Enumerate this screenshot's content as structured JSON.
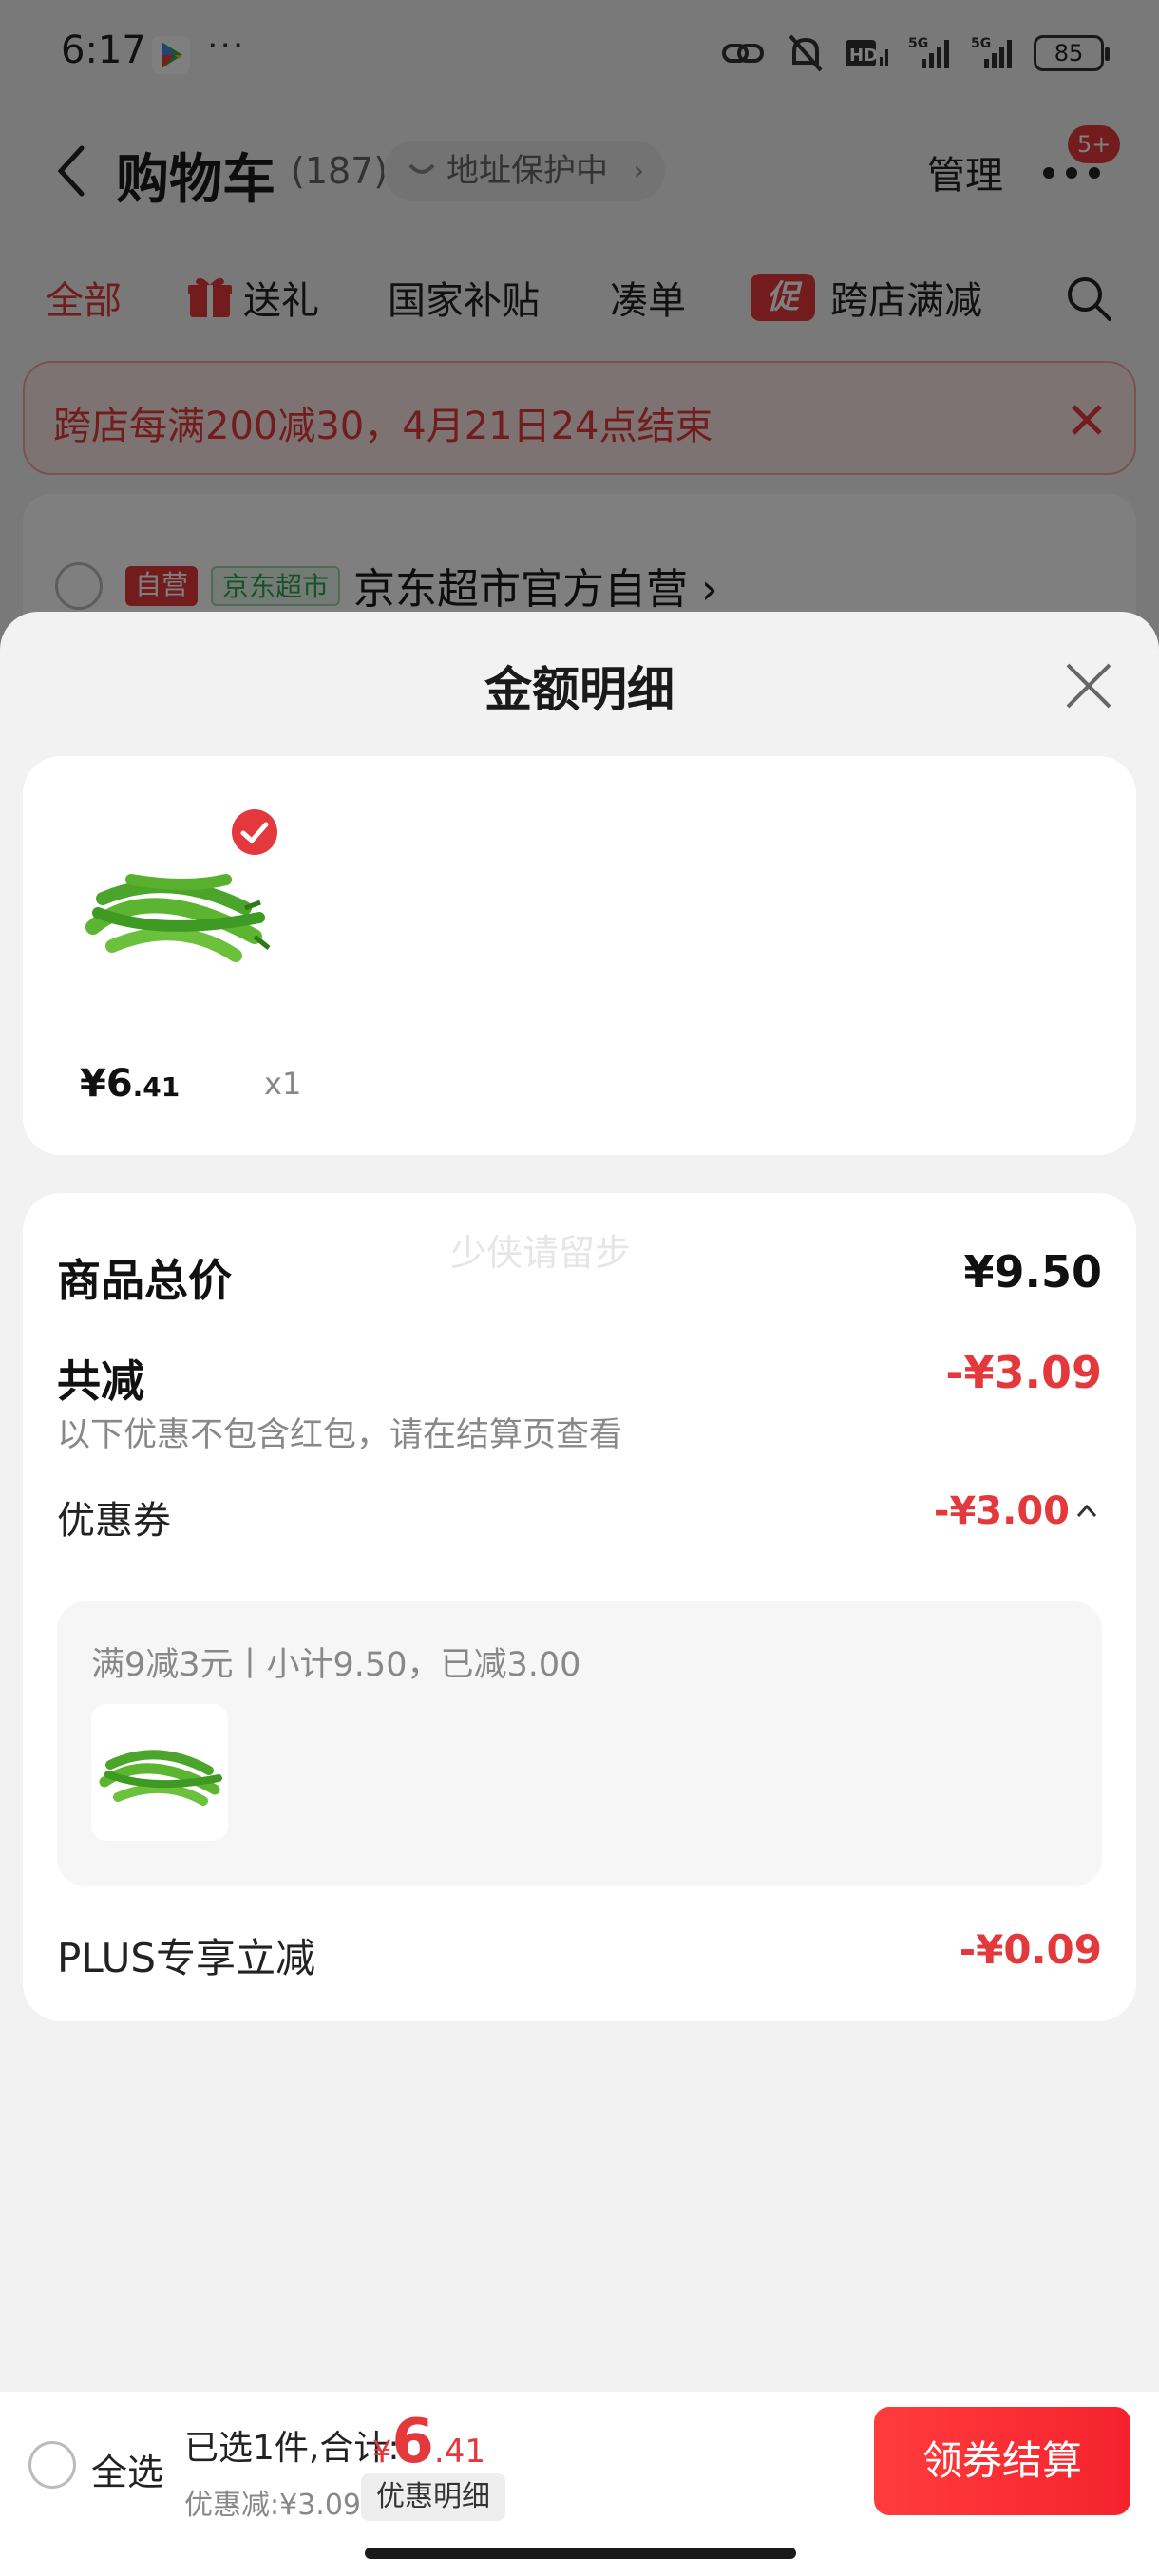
{
  "status_bar": {
    "time": "6:17",
    "more": "···",
    "network_hd": "HD",
    "network_5g_1": "5G",
    "network_5g_2": "5G",
    "battery": "85"
  },
  "header": {
    "title": "购物车",
    "count": "(187)",
    "address_chip": "地址保护中",
    "chevron": "›",
    "manage": "管理",
    "badge": "5+"
  },
  "tabs": [
    {
      "label": "全部",
      "active": true
    },
    {
      "label": "送礼",
      "active": false
    },
    {
      "label": "国家补贴",
      "active": false
    },
    {
      "label": "凑单",
      "active": false
    },
    {
      "label": "跨店满减",
      "active": false,
      "icon_text": "促"
    }
  ],
  "promo_banner": {
    "text": "跨店每满200减30，4月21日24点结束"
  },
  "store": {
    "tag_self": "自营",
    "tag_market": "京东超市",
    "name": "京东超市官方自营 ›"
  },
  "sheet": {
    "title": "金额明细",
    "goods": {
      "price_int": "¥6",
      "price_dec": ".41",
      "qty": "x1"
    },
    "watermark": "少侠请留步",
    "total_label": "商品总价",
    "total_value": "¥9.50",
    "discount_label": "共减",
    "discount_value": "-¥3.09",
    "hint": "以下优惠不包含红包，请在结算页查看",
    "coupon_label": "优惠券",
    "coupon_value": "-¥3.00",
    "coupon_rule": "满9减3元丨小计9.50，已减3.00",
    "plus_label": "PLUS专享立减",
    "plus_value": "-¥0.09"
  },
  "bottom_bar": {
    "select_all": "全选",
    "selected_summary": "已选1件,合计:",
    "total_currency": "¥",
    "total_int": "6",
    "total_dec": ".41",
    "discount_line": "优惠减:¥3.09",
    "detail_chip": "优惠明细",
    "checkout": "领券结算"
  },
  "colors": {
    "accent": "#e4393c",
    "green": "#2da44e"
  }
}
